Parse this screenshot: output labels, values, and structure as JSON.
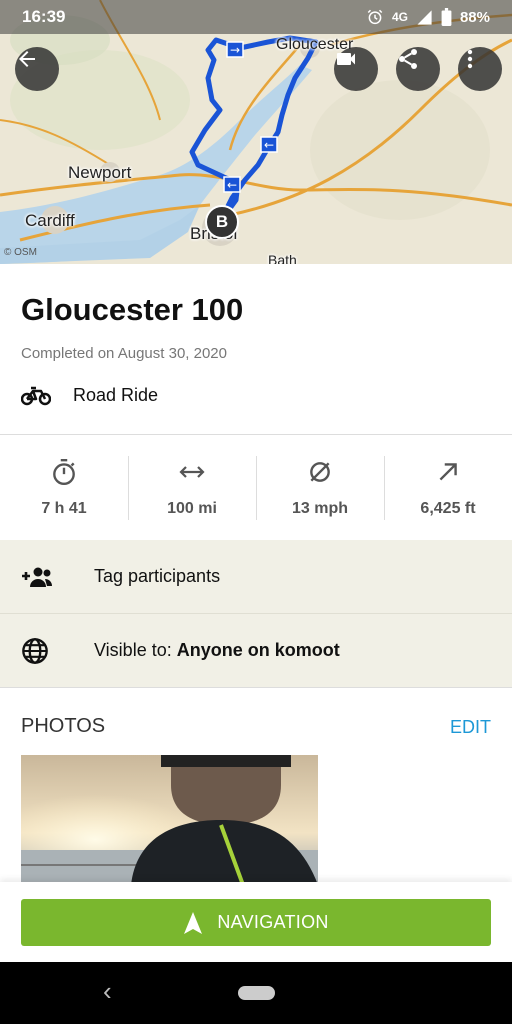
{
  "status_bar": {
    "time": "16:39",
    "network": "4G",
    "battery": "88%"
  },
  "map": {
    "labels": {
      "newport": "Newport",
      "cardiff": "Cardiff",
      "bristol": "Bristol",
      "gloucester": "Gloucester",
      "bath": "Bath"
    },
    "end_marker": "B",
    "attribution": "© OSM",
    "route_color": "#1a54d6"
  },
  "tour": {
    "title": "Gloucester 100",
    "completed": "Completed on August 30, 2020",
    "sport": "Road Ride"
  },
  "stats": [
    {
      "icon": "stopwatch-icon",
      "value": "7 h 41"
    },
    {
      "icon": "distance-icon",
      "value": "100 mi"
    },
    {
      "icon": "average-speed-icon",
      "value": "13 mph"
    },
    {
      "icon": "elevation-up-icon",
      "value": "6,425 ft"
    }
  ],
  "tag_participants": "Tag participants",
  "visibility": {
    "label": "Visible to:",
    "value": "Anyone on komoot"
  },
  "photos": {
    "heading": "PHOTOS",
    "edit": "EDIT"
  },
  "navigation_button": "NAVIGATION",
  "colors": {
    "accent_green": "#7ab72e",
    "link_blue": "#1d98d6",
    "row_bg": "#f1f0e6"
  }
}
